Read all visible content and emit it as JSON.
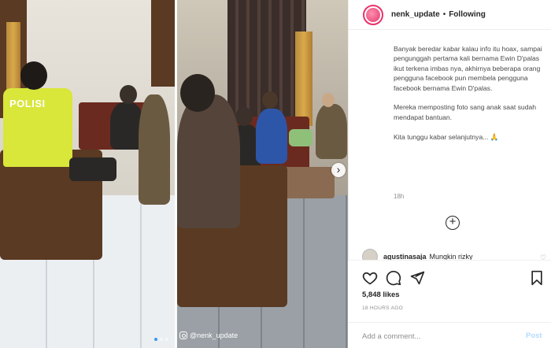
{
  "post": {
    "username": "nenk_update",
    "separator": "•",
    "follow_status": "Following",
    "caption": [
      "Banyak beredar kabar kalau info itu hoax, sampai pengunggah pertama kali bernama Ewin D'palas ikut terkena imbas nya, akhirnya beberapa orang pengguna facebook pun membela pengguna facebook bernama Ewin D'palas.",
      "Mereka memposting foto sang anak saat sudah mendapat bantuan.",
      "Kita tunggu kabar selanjutnya... 🙏"
    ],
    "time_ago": "18h",
    "likes": "5,848 likes",
    "date": "18 HOURS AGO"
  },
  "media": {
    "vest_label": "POLISI",
    "watermark": "@nenk_update",
    "carousel_next": "›",
    "dots_total": 3,
    "dot_active_index": 0
  },
  "comments": [
    {
      "username": "agustinasaja",
      "text": "Mungkin rizky"
    }
  ],
  "load_more": "+",
  "add_comment": {
    "placeholder": "Add a comment...",
    "post_label": "Post"
  },
  "icons": {
    "like": "heart-icon",
    "comment": "comment-icon",
    "share": "share-icon",
    "save": "bookmark-icon"
  },
  "colors": {
    "avatar_ring": "#e8326b",
    "post_disabled": "#b3dbff",
    "dot_active": "#3897f0"
  }
}
